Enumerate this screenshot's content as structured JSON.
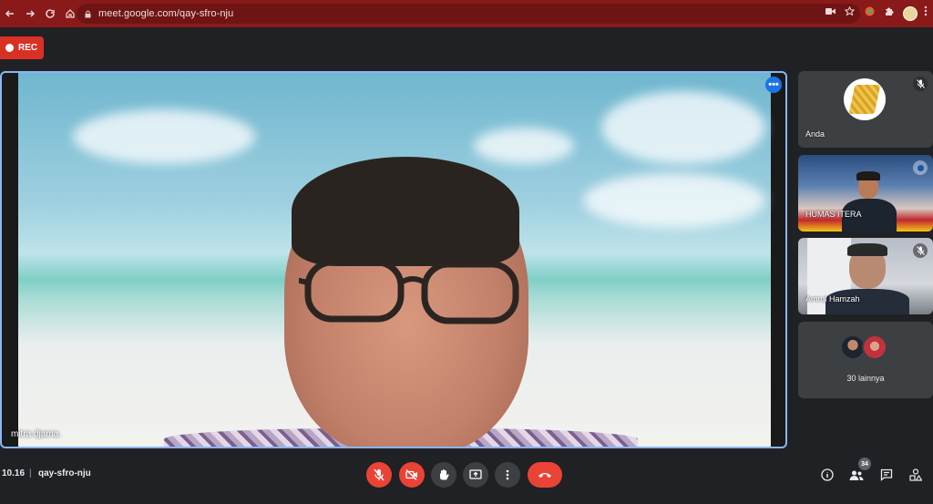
{
  "browser": {
    "url": "meet.google.com/qay-sfro-nju"
  },
  "recording": {
    "label": "REC"
  },
  "stage": {
    "speaker_name": "mitra djama."
  },
  "tiles": [
    {
      "name": "Anda"
    },
    {
      "name": "HUMAS ITERA"
    },
    {
      "name": "Amrul Hamzah"
    }
  ],
  "others": {
    "label": "30 lainnya"
  },
  "bottom_bar": {
    "time": "10.16",
    "separator": "|",
    "meeting_code": "qay-sfro-nju",
    "participants_count": "34"
  },
  "colors": {
    "browser_bar": "#8a1a1a",
    "rec": "#d93025",
    "active_border": "#8ab4f8",
    "end_call": "#ea4335",
    "background": "#202124"
  }
}
